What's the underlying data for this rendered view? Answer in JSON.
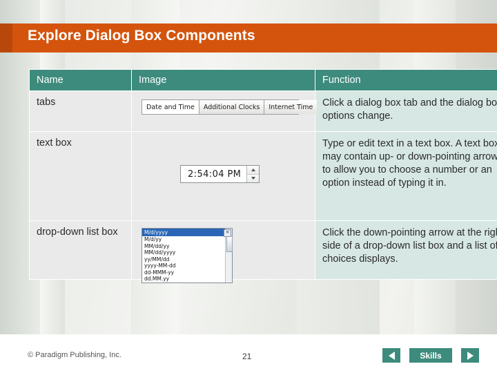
{
  "slide": {
    "title": "Explore Dialog Box Components"
  },
  "table": {
    "headers": {
      "name": "Name",
      "image": "Image",
      "function": "Function"
    },
    "rows": [
      {
        "name": "tabs",
        "function": "Click a dialog box tab and the dialog box options change.",
        "image": {
          "type": "tabs",
          "tabs": [
            "Date and Time",
            "Additional Clocks",
            "Internet Time"
          ]
        }
      },
      {
        "name": "text box",
        "function": "Type or edit text in a text box. A text box may contain up- or down-pointing arrows to allow you to choose a number or an option instead of typing it in.",
        "image": {
          "type": "spinner-text-box",
          "value": "2:54:04 PM"
        }
      },
      {
        "name": "drop-down list box",
        "function": "Click the down-pointing arrow at the right side of a drop-down list box and a list of choices displays.",
        "image": {
          "type": "drop-down-list",
          "selected": "M/d/yyyy",
          "options": [
            "M/d/yy",
            "MM/dd/yy",
            "MM/dd/yyyy",
            "yy/MM/dd",
            "yyyy-MM-dd",
            "dd-MMM-yy",
            "dd.MM.yy"
          ]
        }
      }
    ]
  },
  "footer": {
    "copyright": "© Paradigm Publishing, Inc.",
    "page_number": "21",
    "prev_label": "previous-arrow-icon",
    "next_label": "next-arrow-icon",
    "skills_label": "Skills"
  },
  "colors": {
    "header_orange": "#d4540d",
    "table_header_teal": "#3d8b7d",
    "function_cell": "#d7e8e4",
    "cell_grey": "#eaeaea"
  }
}
